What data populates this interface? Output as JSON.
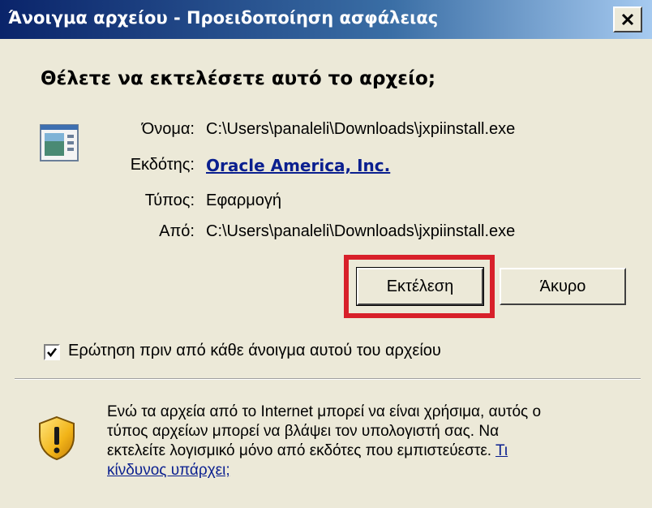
{
  "window": {
    "title": "Άνοιγμα αρχείου - Προειδοποίηση ασφάλειας",
    "close_icon": "close-icon"
  },
  "question": "Θέλετε να εκτελέσετε αυτό το αρχείο;",
  "file_icon": "executable-file-icon",
  "details": {
    "name_label": "Όνομα:",
    "name_value": "C:\\Users\\panaleli\\Downloads\\jxpiinstall.exe",
    "publisher_label": "Εκδότης:",
    "publisher_value": "Oracle America, Inc.",
    "type_label": "Τύπος:",
    "type_value": "Εφαρμογή",
    "from_label": "Από:",
    "from_value": "C:\\Users\\panaleli\\Downloads\\jxpiinstall.exe"
  },
  "buttons": {
    "run": "Εκτέλεση",
    "cancel": "Άκυρο"
  },
  "checkbox": {
    "label": "Ερώτηση πριν από κάθε άνοιγμα αυτού του αρχείου",
    "checked": true
  },
  "warning": {
    "icon": "shield-warning-icon",
    "line1": "Ενώ τα αρχεία από το Internet μπορεί να είναι χρήσιμα, αυτός ο",
    "line2": "τύπος αρχείων μπορεί να βλάψει τον υπολογιστή σας. Να",
    "line3_text": "εκτελείτε λογισμικό μόνο από εκδότες που εμπιστεύεστε. ",
    "link_part1": "Τι",
    "link_part2": "κίνδυνος υπάρχει;"
  },
  "colors": {
    "highlight": "#d8202a",
    "link": "#0a1f8f",
    "dialog_bg": "#ece9d8"
  }
}
